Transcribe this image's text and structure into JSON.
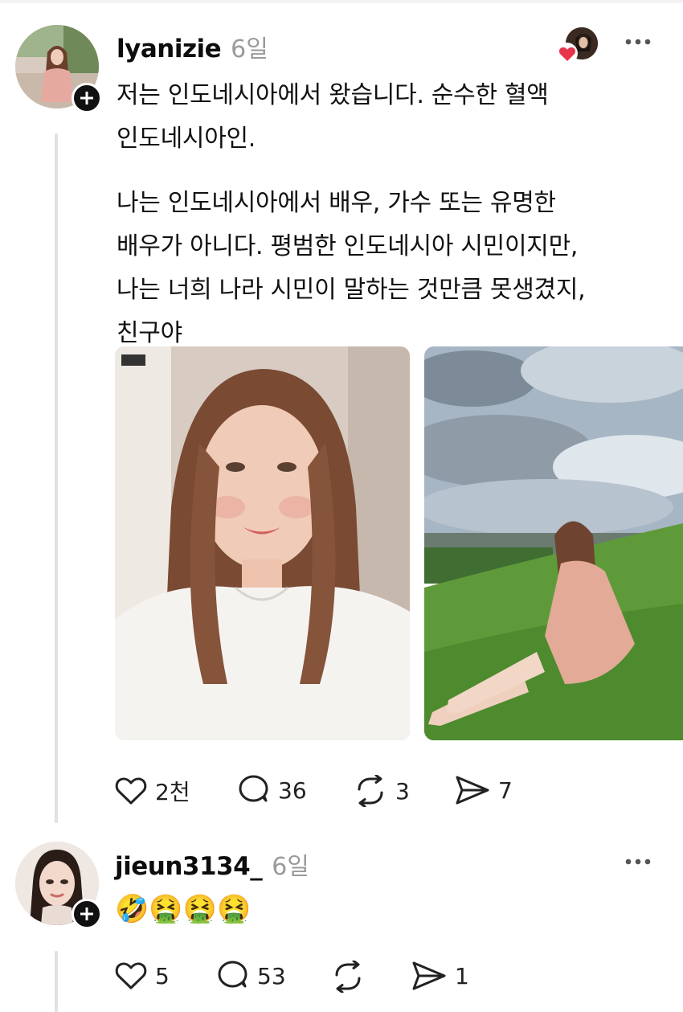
{
  "post": {
    "username": "lyanizie",
    "time": "6일",
    "text_paragraph_1": "저는 인도네시아에서 왔습니다. 순수한 혈액\n인도네시아인.",
    "text_paragraph_2": "나는 인도네시아에서 배우, 가수 또는 유명한\n배우가 아니다. 평범한 인도네시아 시민이지만,\n나는 너희 나라 시민이 말하는 것만큼 못생겼지,\n친구야",
    "actions": {
      "likes": "2천",
      "comments": "36",
      "reposts": "3",
      "shares": "7"
    }
  },
  "reply": {
    "username": "jieun3134_",
    "time": "6일",
    "text": "🤣🤮🤮🤮",
    "actions": {
      "likes": "5",
      "comments": "53",
      "reposts": "",
      "shares": "1"
    }
  },
  "icons": {
    "like": "heart-outline-icon",
    "comment": "speech-bubble-icon",
    "repost": "repost-arrows-icon",
    "share": "send-icon",
    "more": "more-dots-icon",
    "follow": "plus-icon"
  },
  "colors": {
    "heart_badge": "#e8344a",
    "thread_line": "#e1e1e1",
    "muted_text": "#9a9a9a"
  }
}
